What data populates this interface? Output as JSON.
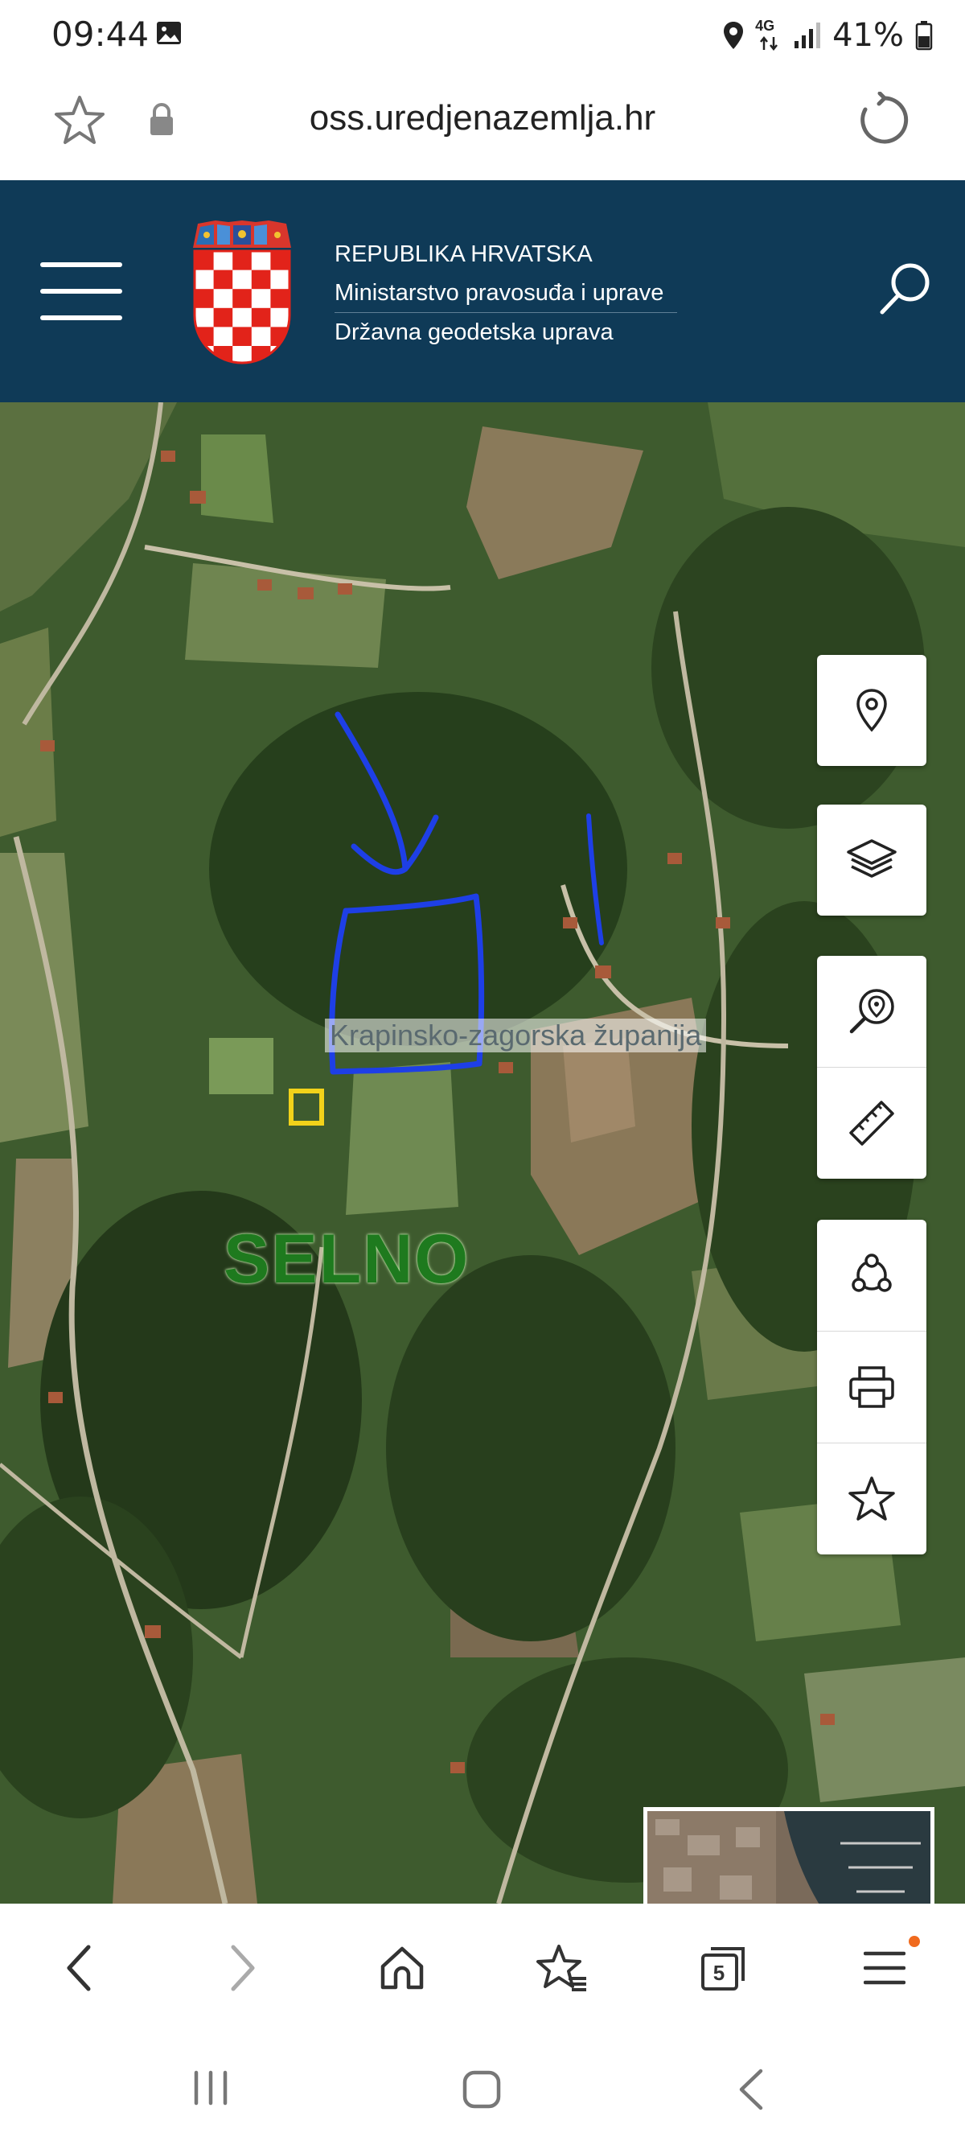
{
  "status_bar": {
    "time": "09:44",
    "network": "4G",
    "battery": "41%",
    "icons": [
      "gallery-icon",
      "location-icon",
      "signal-icon",
      "battery-icon"
    ]
  },
  "browser": {
    "url": "oss.uredjenazemlja.hr",
    "tab_count": "5",
    "icons": [
      "star-icon",
      "lock-icon",
      "reload-icon",
      "back-icon",
      "forward-icon",
      "home-icon",
      "bookmarks-icon",
      "tabs-icon",
      "menu-icon"
    ]
  },
  "site_header": {
    "line1": "REPUBLIKA HRVATSKA",
    "line2": "Ministarstvo pravosuđa i uprave",
    "line3": "Državna geodetska uprava",
    "icons": [
      "hamburger-icon",
      "coat-of-arms",
      "search-icon"
    ]
  },
  "map": {
    "region_label": "Krapinsko-zagorska županija",
    "place_label": "SELNO",
    "tools": [
      "location-pin-icon",
      "layers-icon",
      "search-location-icon",
      "ruler-icon",
      "share-icon",
      "print-icon",
      "favorite-star-icon"
    ]
  },
  "colors": {
    "header_bg": "#0f3a57",
    "annotation_blue": "#1e3fe6",
    "marker_yellow": "#f2d21a",
    "label_green": "#1e7a1e",
    "notification_orange": "#f06a1e"
  }
}
